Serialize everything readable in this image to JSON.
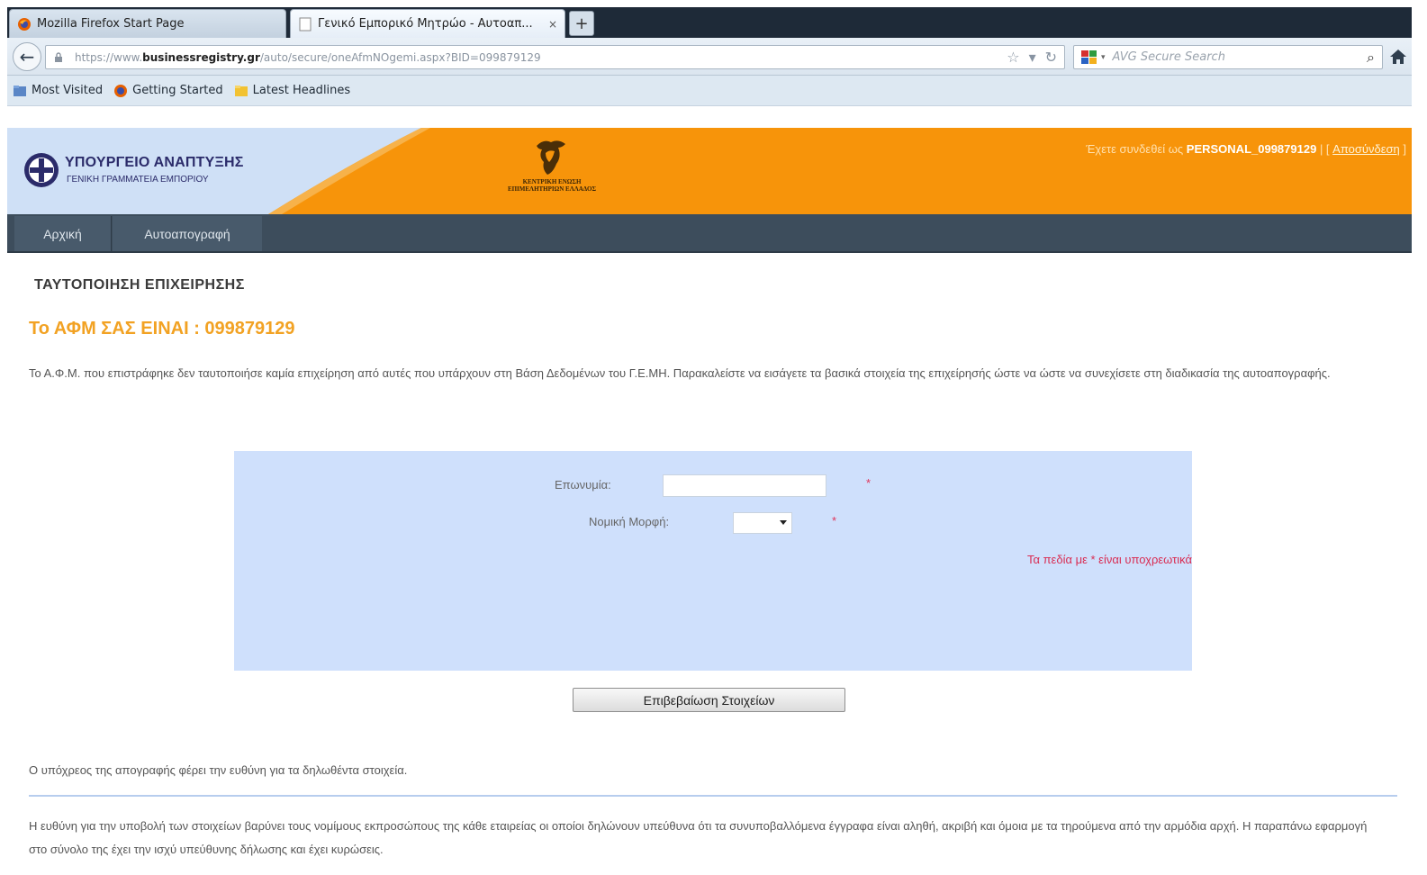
{
  "browser": {
    "tabs": [
      {
        "label": "Mozilla Firefox Start Page",
        "active": false
      },
      {
        "label": "Γενικό Εμπορικό Μητρώο - Αυτοαπ...",
        "active": true
      }
    ],
    "new_tab_label": "+",
    "close_tab_label": "×",
    "url": {
      "prefix": "https://www.",
      "domain": "businessregistry.gr",
      "path": "/auto/secure/oneAfmNOgemi.aspx?BID=099879129"
    },
    "search_placeholder": "AVG Secure Search",
    "bookmarks": [
      {
        "label": "Most Visited",
        "icon": "bookmarks-folder-icon"
      },
      {
        "label": "Getting Started",
        "icon": "firefox-icon"
      },
      {
        "label": "Latest Headlines",
        "icon": "rss-feed-icon"
      }
    ]
  },
  "header": {
    "ministry_name": "ΥΠΟΥΡΓΕΙΟ ΑΝΑΠΤΥΞΗΣ",
    "ministry_sub": "ΓΕΝΙΚΗ ΓΡΑΜΜΑΤΕΙΑ ΕΜΠΟΡΙΟΥ",
    "chamber_text": "ΚΕΝΤΡΙΚΗ ΕΝΩΣΗ ΕΠΙΜΕΛΗΤΗΡΙΩΝ ΕΛΛΑΔΟΣ",
    "login_prefix": "Έχετε συνδεθεί ως",
    "login_user": "PERSONAL_099879129",
    "logout_label": "Αποσύνδεση"
  },
  "nav": {
    "items": [
      "Αρχική",
      "Αυτοαπογραφή"
    ]
  },
  "main": {
    "section_title": "ΤΑΥΤΟΠΟΙΗΣΗ ΕΠΙΧΕΙΡΗΣΗΣ",
    "afm_line": "Το ΑΦΜ ΣΑΣ ΕΙΝΑΙ : 099879129",
    "intro": "Το Α.Φ.Μ. που επιστράφηκε δεν ταυτοποιήσε καμία επιχείρηση από αυτές που υπάρχουν στη Βάση Δεδομένων του Γ.Ε.ΜΗ. Παρακαλείστε να εισάγετε τα βασικά στοιχεία της επιχείρησής ώστε να ώστε να συνεχίσετε στη διαδικασία της αυτοαπογραφής.",
    "form": {
      "name_label": "Επωνυμία:",
      "name_value": "",
      "legal_form_label": "Νομική Μορφή:",
      "legal_form_value": "",
      "required_mark": "*",
      "required_note": "Τα πεδία με * είναι υποχρεωτικά"
    },
    "confirm_button": "Επιβεβαίωση Στοιχείων",
    "responsibility": "Ο υπόχρεος της απογραφής φέρει την ευθύνη για τα δηλωθέντα στοιχεία.",
    "footer": "Η ευθύνη για την υποβολή των στοιχείων βαρύνει τους νομίμους εκπροσώπους της κάθε εταιρείας οι οποίοι δηλώνουν υπεύθυνα ότι τα συνυποβαλλόμενα έγγραφα είναι αληθή, ακριβή και όμοια με τα τηρούμενα από την αρμόδια αρχή. Η παραπάνω εφαρμογή στο σύνολο της έχει την ισχύ υπεύθυνης δήλωσης και έχει κυρώσεις."
  },
  "colors": {
    "header_orange": "#f7940a",
    "afm_orange": "#f2a223",
    "nav_dark": "#3d4d5c",
    "panel_blue": "#cfe0fc",
    "required_red": "#d92c52"
  }
}
